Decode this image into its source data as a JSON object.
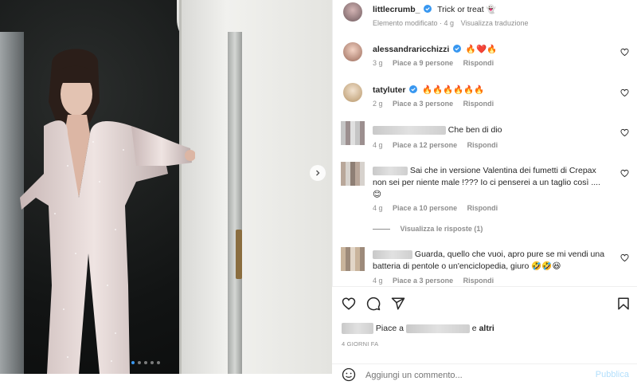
{
  "post": {
    "author": "littlecrumb_",
    "caption": "Trick or treat",
    "caption_emoji": "👻",
    "edited": "Elemento modificato",
    "age": "4 g",
    "translate": "Visualizza traduzione"
  },
  "comments": [
    {
      "user": "alessandraricchizzi",
      "verified": true,
      "text": "🔥❤️🔥",
      "age": "3 g",
      "likes": "Piace a 9 persone",
      "reply": "Rispondi"
    },
    {
      "user": "tatyluter",
      "verified": true,
      "text": "🔥🔥🔥🔥🔥🔥",
      "age": "2 g",
      "likes": "Piace a 3 persone",
      "reply": "Rispondi"
    },
    {
      "user": "",
      "text": "Che ben di dio",
      "age": "4 g",
      "likes": "Piace a 12 persone",
      "reply": "Rispondi"
    },
    {
      "user": "",
      "text": "Sai che in versione Valentina dei fumetti di Crepax non sei per niente male !??? Io ci penserei a un taglio così .... 😊",
      "age": "4 g",
      "likes": "Piace a 10 persone",
      "reply": "Rispondi",
      "view_replies": "Visualizza le risposte (1)"
    },
    {
      "user": "",
      "text": "Guarda, quello che vuoi, apro pure se mi vendi una batteria di pentole o un'enciclopedia, giuro 🤣🤣😆",
      "age": "4 g",
      "likes": "Piace a 3 persone",
      "reply": "Rispondi"
    }
  ],
  "likes_summary": {
    "prefix": "Piace a",
    "suffix": "e",
    "others": "altri"
  },
  "post_age": "4 GIORNI FA",
  "add_comment": {
    "placeholder": "Aggiungi un commento...",
    "publish": "Pubblica"
  },
  "colors": {
    "accent": "#0095f6",
    "publish_disabled": "#b2dffc",
    "muted": "#8e8e8e"
  },
  "icons": [
    "heart-icon",
    "comment-icon",
    "share-icon",
    "bookmark-icon",
    "emoji-icon",
    "verified-icon",
    "next-arrow-icon"
  ],
  "carousel": {
    "slides": 5,
    "active": 1
  }
}
